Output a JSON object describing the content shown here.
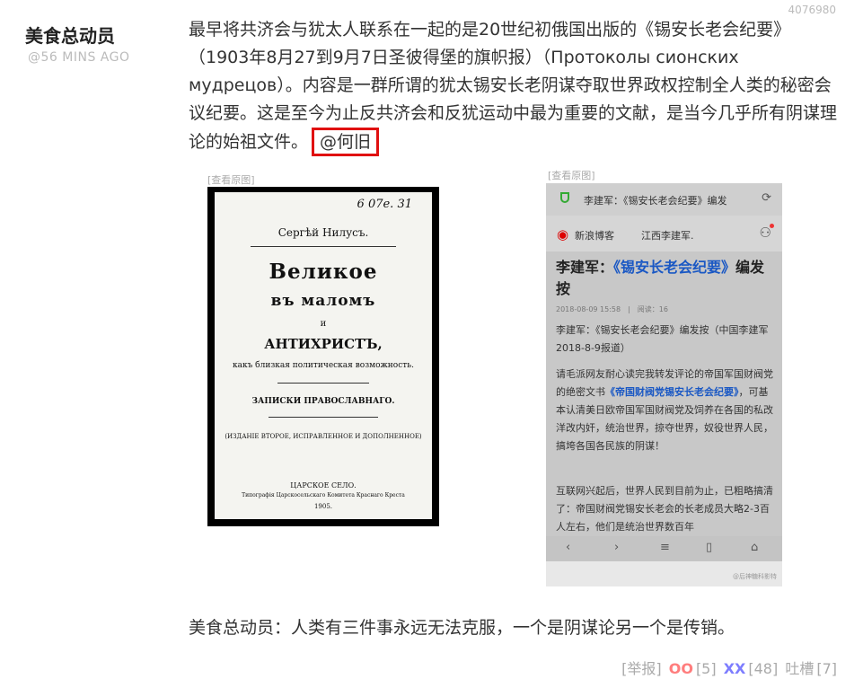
{
  "comment": {
    "id": "4076980",
    "author": "美食总动员",
    "time": "@56 MINS AGO",
    "text": "最早将共济会与犹太人联系在一起的是20世纪初俄国出版的《锡安长老会纪要》（1903年8月27到9月7日圣彼得堡的旗帜报）（Протоколы сионских мудрецов）。内容是一群所谓的犹太锡安长老阴谋夺取世界政权控制全人类的秘密会议纪要。这是至今为止反共济会和反犹运动中最为重要的文献，是当今几乎所有阴谋理论的始祖文件。",
    "mention": "@何旧",
    "reply": "美食总动员：人类有三件事永远无法克服，一个是阴谋论另一个是传销。"
  },
  "images": {
    "view_original_label": "[查看原图]",
    "book": {
      "handwriting": "6 07е. 31",
      "author": "Сергѣй Нилусъ.",
      "title_line1": "Великое",
      "title_line2": "въ маломъ",
      "and": "и",
      "title_line3": "АНТИХРИСТЪ,",
      "subtitle": "какъ близкая политическая возможность.",
      "notes": "ЗАПИСКИ ПРАВОСЛАВНАГО.",
      "edition": "(ИЗДАНІЕ ВТОРОЕ, ИСПРАВЛЕННОЕ И ДОПОЛНЕННОЕ)",
      "city": "ЦАРСКОЕ СЕЛО.",
      "press": "Типографія Царскосельскаго Комитета Краснаго Креста",
      "year": "1905."
    },
    "phone": {
      "bar_title": "李建军：《锡安长老会纪要》编发",
      "sina_blog": "新浪博客",
      "blogger": "江西李建军.",
      "post_title_prefix": "李建军：",
      "post_title_highlight": "《锡安长老会纪要》",
      "post_title_suffix": "编发按",
      "meta": "2018-08-09 15:58　|　阅读：16",
      "para1": "李建军：《锡安长老会纪要》编发按（中国李建军2018-8-9报道）",
      "para2_a": "请毛派网友耐心读完我转发评论的帝国军国财阀党的绝密文书",
      "para2_hl": "《帝国财阀党锡安长老会纪要》",
      "para2_b": "，可基本认清美日欧帝国军国财阀党及饲养在各国的私改洋改内奸，统治世界，掠夺世界，奴役世界人民，搞垮各国各民族的阴谋！",
      "para3": "互联网兴起后，世界人民到目前为止，已粗略搞清了：帝国财阀党锡安长老会的长老成员大略2-3百人左右，他们是统治世界数百年",
      "watermark": "@后神糖科影特"
    }
  },
  "footer": {
    "report": "[举报]",
    "oo_label": "OO",
    "oo_count": "[5]",
    "xx_label": "XX",
    "xx_count": "[48]",
    "tucao_label": "吐槽",
    "tucao_count": "[7]"
  },
  "colors": {
    "mention_border": "#e01010",
    "oo": "#ff7d7d",
    "xx": "#7d7dff",
    "link_blue": "#1a58c4"
  }
}
